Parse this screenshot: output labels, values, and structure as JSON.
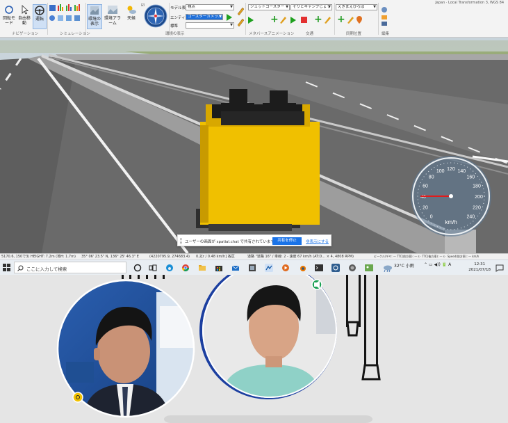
{
  "ribbon": {
    "title_right": "Japan · Local Transformation 3, WGS 84",
    "buttons": {
      "rotate": "回転モード",
      "free_move": "自由移動",
      "driving": "運転",
      "environment": "環境の表示",
      "scene_env": "環境アラーム",
      "weather": "天候"
    },
    "group_labels": {
      "navigation": "ナビゲーション",
      "simulation": "シミュレーション",
      "environment_display": "環境の表示",
      "metaverse_animation": "メタバースアニメーション",
      "transport": "交通",
      "sync_position": "同期位置",
      "edit": "編集"
    },
    "model_display_label": "モデル表示",
    "model_display_value": "視点",
    "entity_label": "エンティティ",
    "entity_value": "コースターカメラ…",
    "standard_label": "標準",
    "standard_value": "",
    "animation_combo_value": "ジェットコースター",
    "animation_combo2_value": "そりとキャンプじょう",
    "sync_combo_value": "えきまえびろば"
  },
  "viewport": {
    "speedometer": {
      "unit": "km/h",
      "ticks": [
        "0",
        "20",
        "40",
        "60",
        "80",
        "100",
        "120",
        "140",
        "160",
        "180",
        "200",
        "220",
        "240"
      ],
      "speed": 40
    },
    "share_notice": {
      "text": "ユーザーの画面が spatial.chat で共有されています。",
      "stop_label": "共有を停止",
      "hide_label": "非表示にする"
    }
  },
  "statusbar": {
    "left": "5170.6, 150で3) HEIGHT: 7.2m (地H: 1.7m)",
    "coords": "35° 06' 23.5\" N, 136° 25' 46.3\" E",
    "grid": "(4220795.9, 274683.4)",
    "speed_text": "0.2[r / 0.48 km/h]  各区",
    "road_info": "道路 \"道路 16\" / 車線: 2 - 速度 67 km/h (AT:D…  × 4, 4808 RPM)",
    "right_info": "ビークル/ギヤ: — TTC(前方車): — s · TTC(後方車): — s · Speed(前方車): — km/h"
  },
  "taskbar": {
    "search_placeholder": "ここに入力して検索",
    "weather": "32°C  小雨",
    "time": "12:31",
    "date": "2021/07/18"
  },
  "meeting": {
    "participants": [
      {
        "role": "presenter",
        "status_color": "#f2c200"
      },
      {
        "role": "student",
        "status_color": "#1aa053"
      }
    ]
  },
  "colors": {
    "accent": "#1e6fd9",
    "vehicle_yellow": "#f0c000",
    "grass": "#7a9a58",
    "road": "#5f5f5f"
  }
}
